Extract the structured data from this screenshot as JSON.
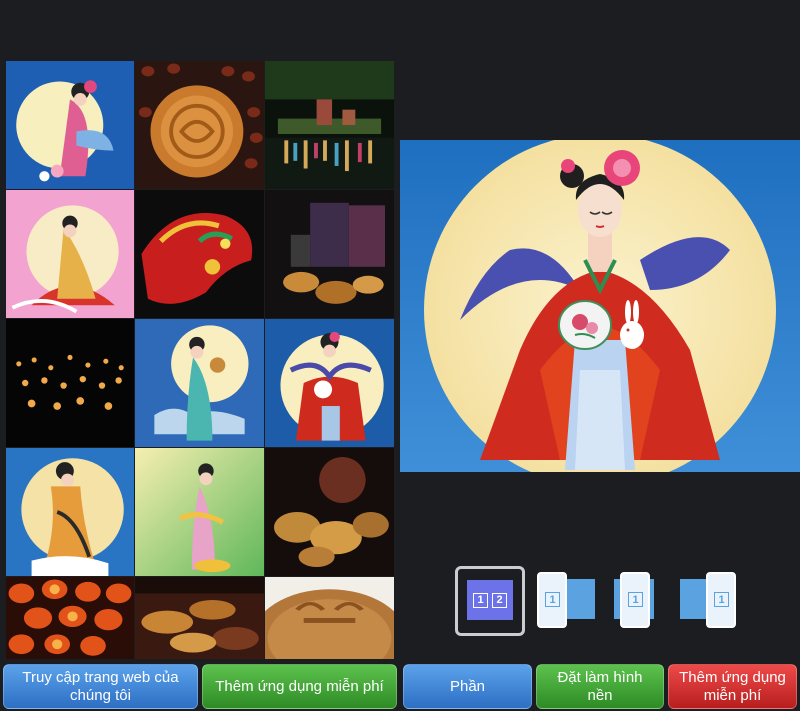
{
  "gallery": {
    "tiles": [
      "moon-lady-fan-icon",
      "mooncake-beans-icon",
      "lantern-festival-night-icon",
      "lady-pink-background-icon",
      "red-dragon-icon",
      "tea-box-mooncakes-icon",
      "floating-lanterns-icon",
      "lady-holding-mooncake-icon",
      "lady-with-rabbit-icon",
      "lady-yellow-moon-icon",
      "lady-green-background-icon",
      "mooncakes-plate-icon",
      "red-lanterns-icon",
      "mooncakes-teapot-icon",
      "mooncake-closeup-icon"
    ]
  },
  "preview": {
    "image": "moon-lady-with-rabbit-icon"
  },
  "layout_options": [
    {
      "screens": [
        "1",
        "2"
      ]
    },
    {
      "screens": [
        "1"
      ]
    },
    {
      "screens": [
        "1"
      ]
    },
    {
      "screens": [
        "1"
      ]
    }
  ],
  "buttons": {
    "visit_website": "Truy cập trang web của chúng tôi",
    "add_free_apps": "Thêm ứng dụng miễn phí",
    "share": "Phần",
    "set_wallpaper": "Đặt làm hình nền",
    "add_free_apps_2": "Thêm ứng dụng miễn phí"
  },
  "colors": {
    "background": "#1b1d20",
    "accent_blue": "#3b82d6",
    "accent_green": "#3ea535",
    "accent_red": "#d93030",
    "selected_layout": "#6c72e8"
  }
}
